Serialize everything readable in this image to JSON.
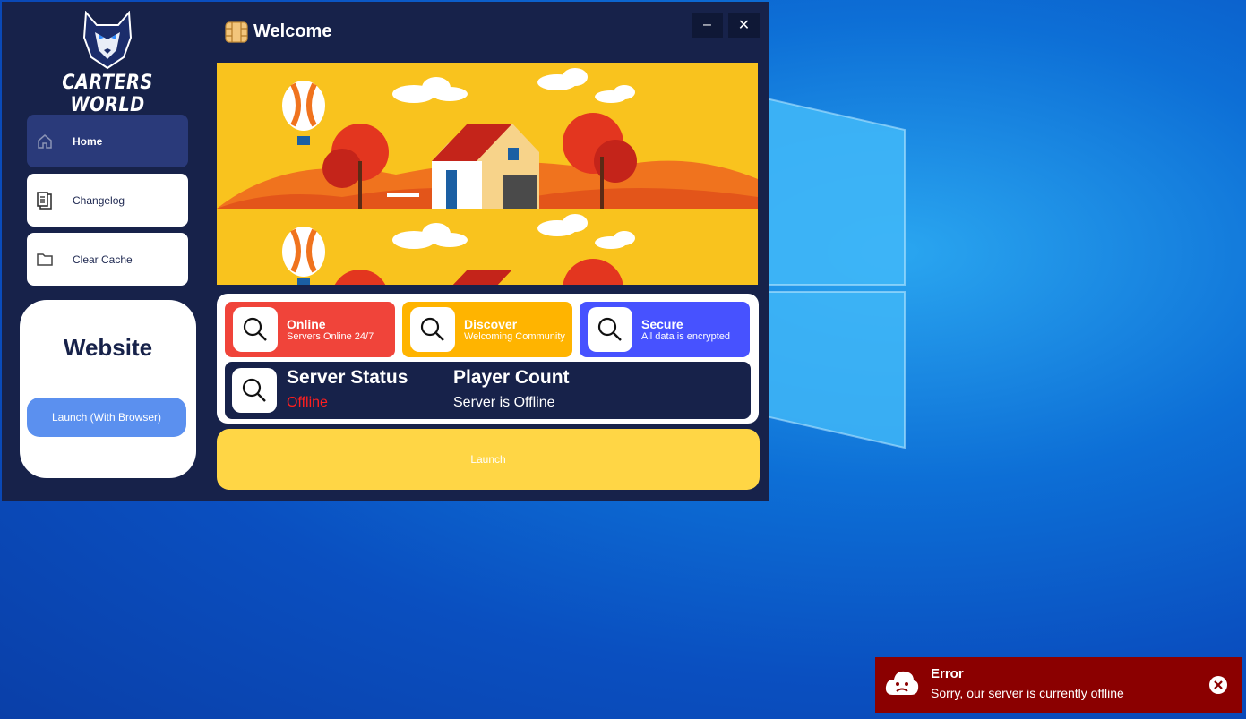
{
  "app": {
    "brand": "CARTERS WORLD",
    "title": "Welcome",
    "window_controls": {
      "minimize": "–",
      "close": "✕"
    }
  },
  "sidebar": {
    "items": [
      {
        "label": "Home",
        "icon": "home-icon",
        "active": true
      },
      {
        "label": "Changelog",
        "icon": "clipboard-icon",
        "active": false
      },
      {
        "label": "Clear Cache",
        "icon": "folder-icon",
        "active": false
      }
    ],
    "website_card": {
      "title": "Website",
      "button": "Launch (With Browser)"
    }
  },
  "features": [
    {
      "title": "Online",
      "subtitle": "Servers Online 24/7",
      "color": "#f0443a",
      "icon": "search-icon"
    },
    {
      "title": "Discover",
      "subtitle": "Welcoming Community",
      "color": "#ffb400",
      "icon": "search-icon"
    },
    {
      "title": "Secure",
      "subtitle": "All data is encrypted",
      "color": "#4752ff",
      "icon": "search-icon"
    }
  ],
  "status": {
    "server_status_label": "Server Status",
    "server_status_value": "Offline",
    "player_count_label": "Player Count",
    "player_count_value": "Server is Offline"
  },
  "launch_button": "Launch",
  "toast": {
    "title": "Error",
    "message": "Sorry, our server is currently offline",
    "icon": "sad-cloud-icon",
    "background": "#8b0000"
  },
  "colors": {
    "window": "#17224a",
    "accent_blue": "#5b90ef",
    "launch_yellow": "#ffd645",
    "offline_red": "#ff1f1f"
  }
}
